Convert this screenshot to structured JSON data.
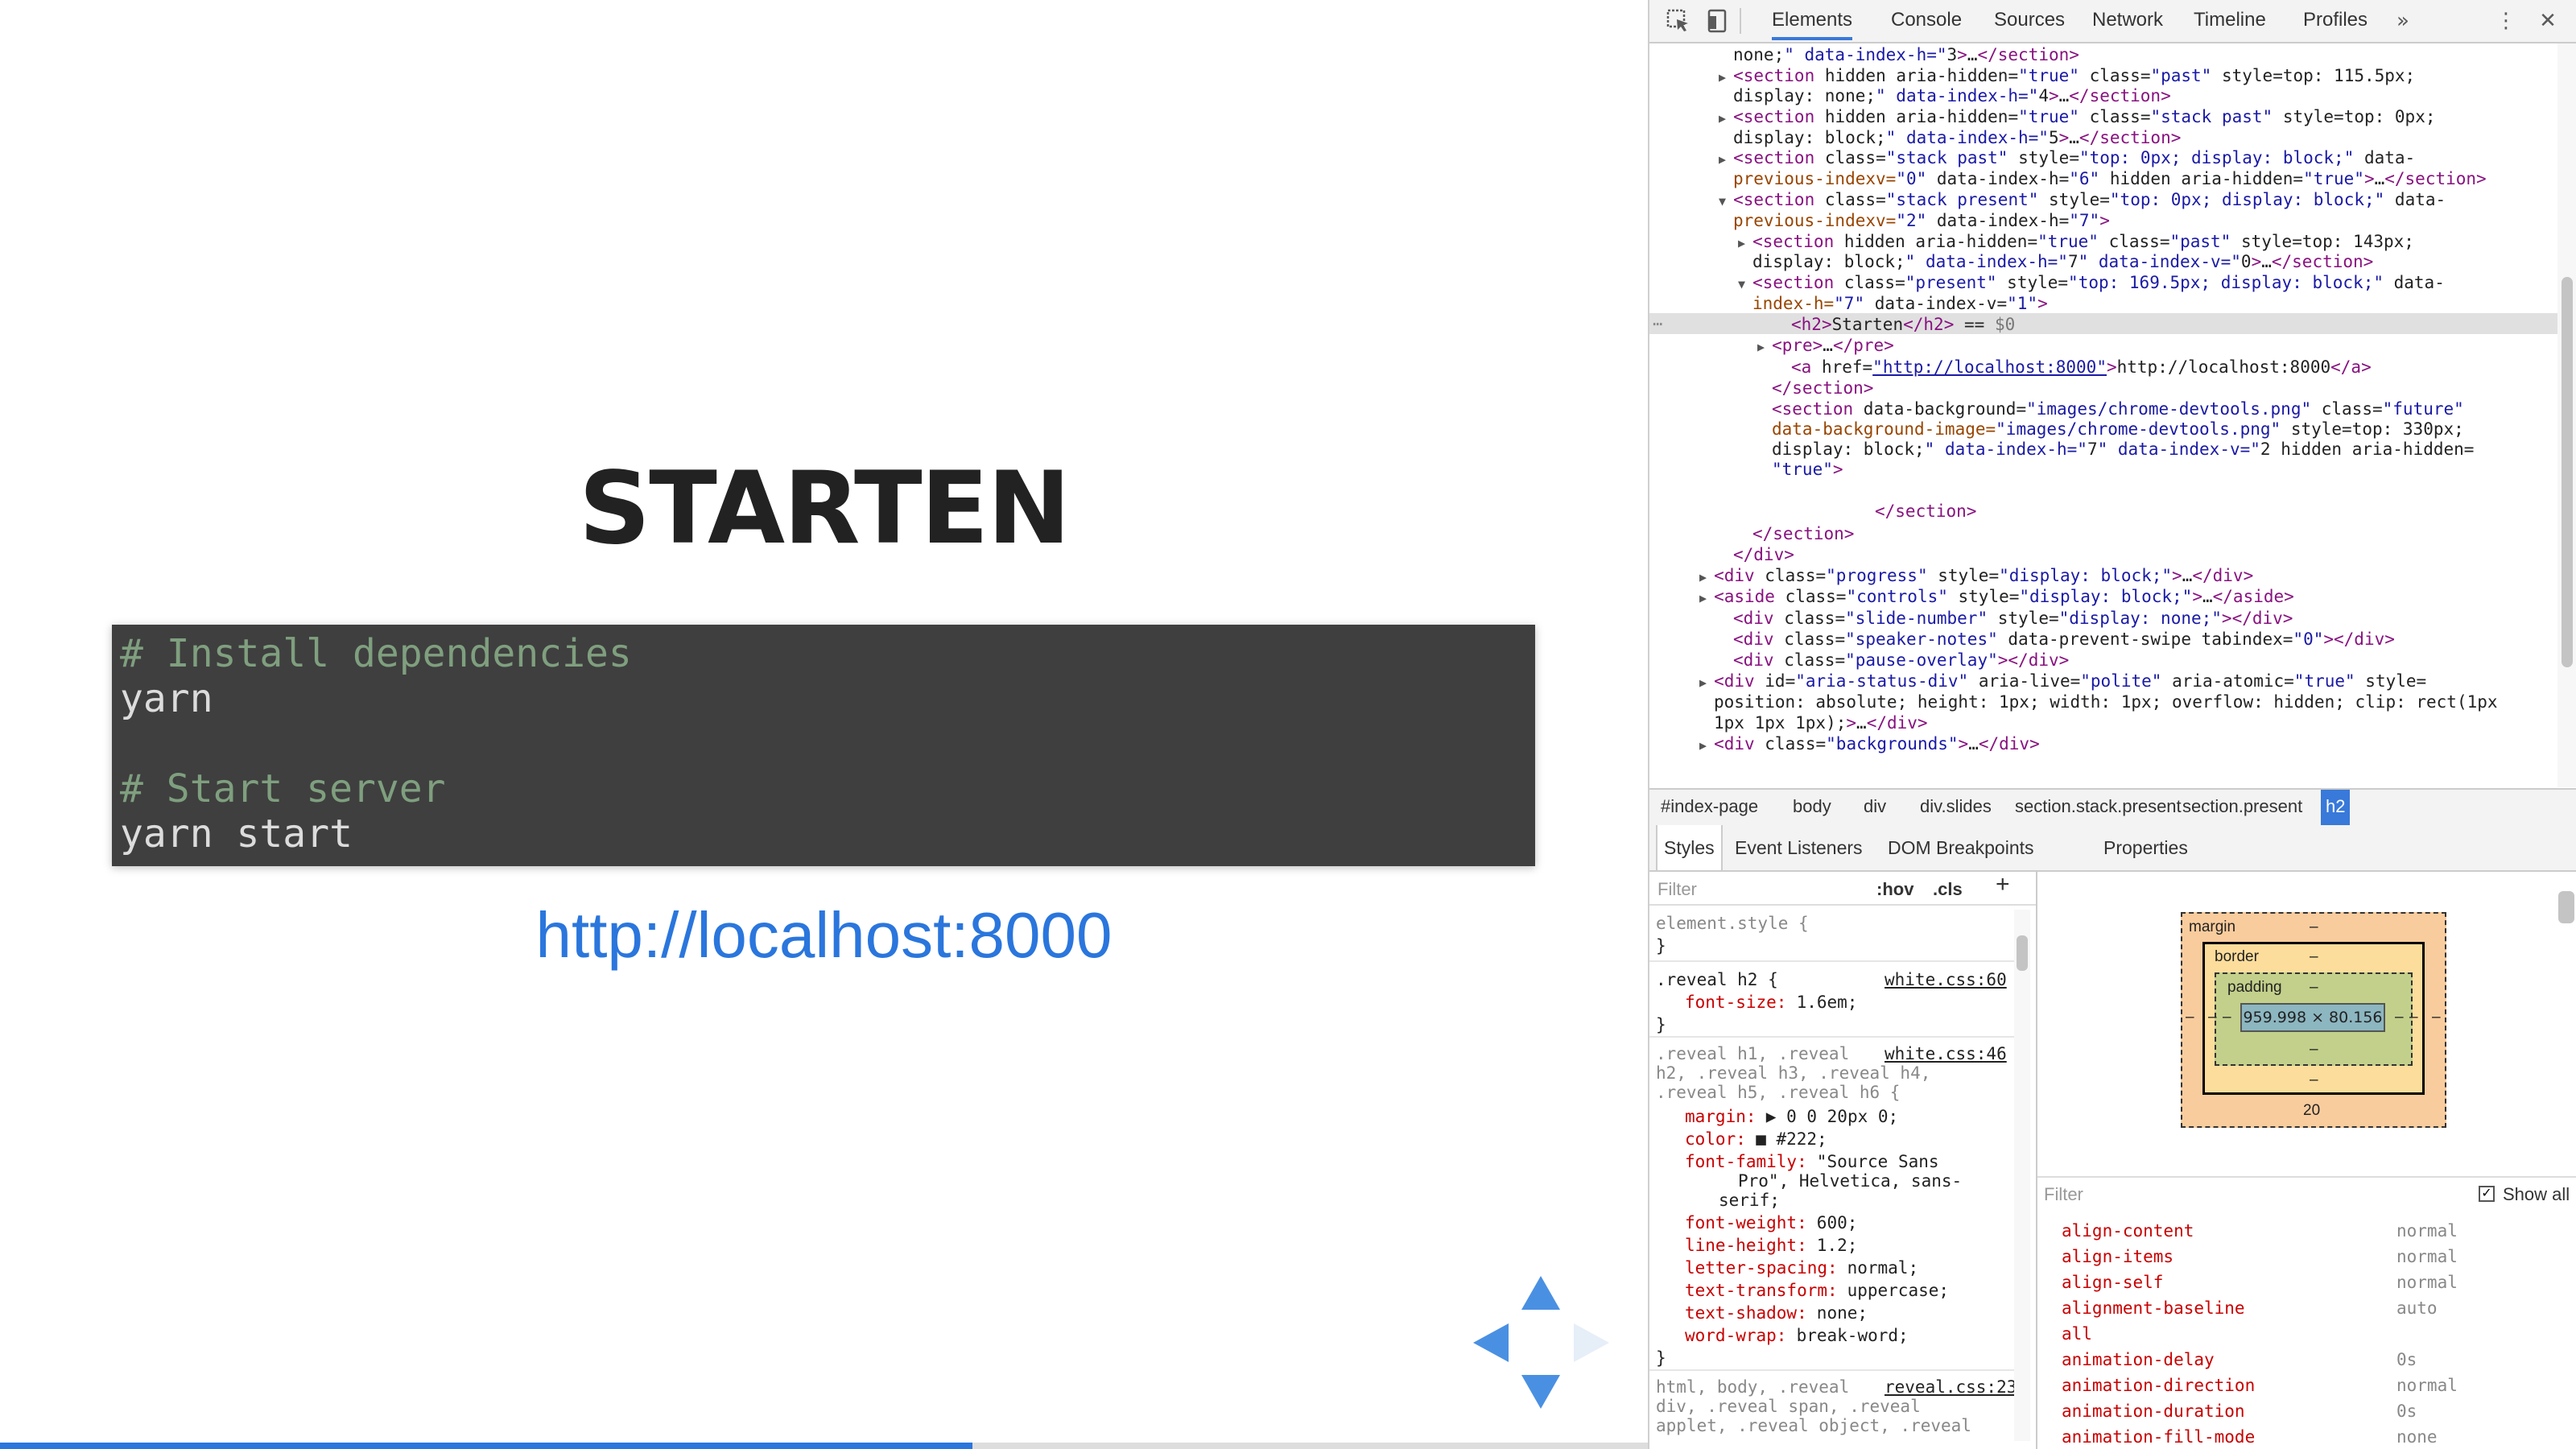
{
  "slide": {
    "title": "Starten",
    "code_lines": [
      {
        "text": "# Install dependencies",
        "kind": "comment"
      },
      {
        "text": "yarn",
        "kind": "code"
      },
      {
        "text": "",
        "kind": "code"
      },
      {
        "text": "# Start server",
        "kind": "comment"
      },
      {
        "text": "yarn start",
        "kind": "code"
      }
    ],
    "link": "http://localhost:8000",
    "progress_fraction": 0.59
  },
  "devtools": {
    "tabs": [
      {
        "label": "Elements",
        "active": true
      },
      {
        "label": "Console",
        "active": false
      },
      {
        "label": "Sources",
        "active": false
      },
      {
        "label": "Network",
        "active": false
      },
      {
        "label": "Timeline",
        "active": false
      },
      {
        "label": "Profiles",
        "active": false
      }
    ],
    "more_tabs_glyph": "»",
    "menu_glyph": "⋮",
    "close_glyph": "✕",
    "icons": [
      "inspect-icon",
      "device-mode-icon",
      "more-tabs-icon",
      "kebab-menu-icon",
      "close-icon"
    ],
    "dom_lines": [
      {
        "indent": 4,
        "arrow": "",
        "html": "none;\" data-index-h=\"3\">…</section>"
      },
      {
        "indent": 4,
        "arrow": "▶",
        "tag": "section",
        "attrs": [
          [
            "hidden",
            ""
          ],
          [
            "aria-hidden",
            "true"
          ],
          [
            "class",
            "past"
          ],
          [
            "style",
            "top: 115.5px;"
          ]
        ],
        "cont": "display: none;\" data-index-h=\"4\">…</section>"
      },
      {
        "indent": 4,
        "arrow": "▶",
        "tag": "section",
        "attrs": [
          [
            "hidden",
            ""
          ],
          [
            "aria-hidden",
            "true"
          ],
          [
            "class",
            "stack past"
          ],
          [
            "style",
            "top: 0px;"
          ]
        ],
        "cont": "display: block;\" data-index-h=\"5\">…</section>"
      },
      {
        "indent": 4,
        "arrow": "▶",
        "tag": "section",
        "attrs": [
          [
            "class",
            "stack past"
          ],
          [
            "style",
            "top: 0px; display: block;"
          ],
          [
            "data-",
            ""
          ]
        ],
        "cont": "previous-indexv=\"0\" data-index-h=\"6\" hidden aria-hidden=\"true\">…</section>"
      },
      {
        "indent": 4,
        "arrow": "▼",
        "tag": "section",
        "attrs": [
          [
            "class",
            "stack present"
          ],
          [
            "style",
            "top: 0px; display: block;"
          ],
          [
            "data-",
            ""
          ]
        ],
        "cont": "previous-indexv=\"2\" data-index-h=\"7\">"
      },
      {
        "indent": 5,
        "arrow": "▶",
        "tag": "section",
        "attrs": [
          [
            "hidden",
            ""
          ],
          [
            "aria-hidden",
            "true"
          ],
          [
            "class",
            "past"
          ],
          [
            "style",
            "top: 143px;"
          ]
        ],
        "cont": "display: block;\" data-index-h=\"7\" data-index-v=\"0\">…</section>"
      },
      {
        "indent": 5,
        "arrow": "▼",
        "tag": "section",
        "attrs": [
          [
            "class",
            "present"
          ],
          [
            "style",
            "top: 169.5px; display: block;"
          ],
          [
            "data-",
            ""
          ]
        ],
        "cont": "index-h=\"7\" data-index-v=\"1\">"
      },
      {
        "indent": 7,
        "arrow": "",
        "selected": true,
        "text": "<h2>Starten</h2> == $0"
      },
      {
        "indent": 6,
        "arrow": "▶",
        "text": "<pre>…</pre>"
      },
      {
        "indent": 7,
        "arrow": "",
        "text": "<a href=\"http://localhost:8000\">http://localhost:8000</a>"
      },
      {
        "indent": 6,
        "arrow": "",
        "text": "</section>"
      },
      {
        "indent": 6,
        "arrow": "",
        "text": "<section data-background=\"images/chrome-devtools.png\" class=\"future\""
      },
      {
        "indent": 6,
        "arrow": "",
        "text": "data-background-image=\"images/chrome-devtools.png\" style=\"top: 330px;"
      },
      {
        "indent": 6,
        "arrow": "",
        "text": "display: block;\" data-index-h=\"7\" data-index-v=\"2\" hidden aria-hidden="
      },
      {
        "indent": 6,
        "arrow": "",
        "text": "\"true\">"
      },
      {
        "indent": 6,
        "arrow": "",
        "text": ""
      },
      {
        "indent": 11,
        "arrow": "",
        "text": "</section>"
      },
      {
        "indent": 5,
        "arrow": "",
        "text": "</section>"
      },
      {
        "indent": 4,
        "arrow": "",
        "text": "</div>"
      },
      {
        "indent": 3,
        "arrow": "▶",
        "text": "<div class=\"progress\" style=\"display: block;\">…</div>"
      },
      {
        "indent": 3,
        "arrow": "▶",
        "text": "<aside class=\"controls\" style=\"display: block;\">…</aside>"
      },
      {
        "indent": 4,
        "arrow": "",
        "text": "<div class=\"slide-number\" style=\"display: none;\"></div>"
      },
      {
        "indent": 4,
        "arrow": "",
        "text": "<div class=\"speaker-notes\" data-prevent-swipe tabindex=\"0\"></div>"
      },
      {
        "indent": 4,
        "arrow": "",
        "text": "<div class=\"pause-overlay\"></div>"
      },
      {
        "indent": 3,
        "arrow": "▶",
        "text": "<div id=\"aria-status-div\" aria-live=\"polite\" aria-atomic=\"true\" style="
      },
      {
        "indent": 3,
        "arrow": "",
        "text": "\"position: absolute; height: 1px; width: 1px; overflow: hidden; clip: rect(1px"
      },
      {
        "indent": 3,
        "arrow": "",
        "text": "1px 1px 1px);\">…</div>"
      },
      {
        "indent": 3,
        "arrow": "▶",
        "text": "<div class=\"backgrounds\">…</div>"
      }
    ],
    "breadcrumbs": [
      {
        "label": "#index-page",
        "active": false
      },
      {
        "label": "body",
        "active": false
      },
      {
        "label": "div",
        "active": false
      },
      {
        "label": "div.slides",
        "active": false
      },
      {
        "label": "section.stack.present",
        "active": false
      },
      {
        "label": "section.present",
        "active": false
      },
      {
        "label": "h2",
        "active": true
      }
    ],
    "sub_tabs": [
      {
        "label": "Styles",
        "active": true
      },
      {
        "label": "Event Listeners",
        "active": false
      },
      {
        "label": "DOM Breakpoints",
        "active": false
      },
      {
        "label": "Properties",
        "active": false
      }
    ],
    "styles": {
      "filter_placeholder": "Filter",
      "hov": ":hov",
      "cls": ".cls",
      "add": "+",
      "element_style": "element.style {",
      "close_brace": "}",
      "rule1": {
        "selector": ".reveal h2 {",
        "source": "white.css:60",
        "props": [
          [
            "font-size",
            "1.6em;"
          ]
        ]
      },
      "rule2": {
        "selector_lines": [
          ".reveal h1, .reveal",
          "h2, .reveal h3, .reveal h4,",
          ".reveal h5, .reveal h6 {"
        ],
        "source": "white.css:46",
        "props": [
          [
            "margin",
            "▶ 0 0 20px 0;"
          ],
          [
            "color",
            "■ #222;"
          ],
          [
            "font-family",
            "\"Source Sans"
          ],
          [
            "",
            "Pro\", Helvetica, sans-"
          ],
          [
            "",
            "serif;"
          ],
          [
            "font-weight",
            "600;"
          ],
          [
            "line-height",
            "1.2;"
          ],
          [
            "letter-spacing",
            "normal;"
          ],
          [
            "text-transform",
            "uppercase;"
          ],
          [
            "text-shadow",
            "none;"
          ],
          [
            "word-wrap",
            "break-word;"
          ]
        ]
      },
      "rule3": {
        "selector_lines": [
          "html, body, .reveal",
          "div, .reveal span, .reveal",
          "applet, .reveal object, .reveal"
        ],
        "source": "reveal.css:23"
      }
    },
    "box_model": {
      "margin_label": "margin",
      "border_label": "border",
      "padding_label": "padding",
      "content": "959.998 × 80.156",
      "dash": "–",
      "margin_bottom": "20"
    },
    "computed": {
      "filter_placeholder": "Filter",
      "show_all": "Show all",
      "rows": [
        {
          "name": "align-content",
          "value": "normal"
        },
        {
          "name": "align-items",
          "value": "normal"
        },
        {
          "name": "align-self",
          "value": "normal"
        },
        {
          "name": "alignment-baseline",
          "value": "auto"
        },
        {
          "name": "all",
          "value": ""
        },
        {
          "name": "animation-delay",
          "value": "0s"
        },
        {
          "name": "animation-direction",
          "value": "normal"
        },
        {
          "name": "animation-duration",
          "value": "0s"
        },
        {
          "name": "animation-fill-mode",
          "value": "none"
        }
      ]
    }
  }
}
